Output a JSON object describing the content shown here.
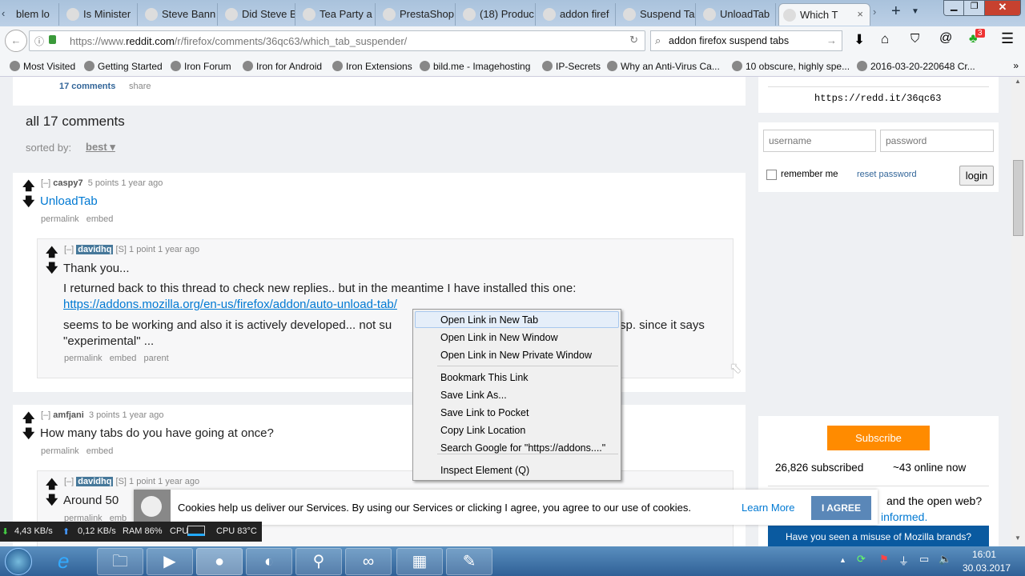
{
  "tabs": [
    {
      "label": "blem lo",
      "icon": "page-icon"
    },
    {
      "label": "Is Minister",
      "icon": "portrait-icon"
    },
    {
      "label": "Steve Bann",
      "icon": "google-icon"
    },
    {
      "label": "Did Steve B",
      "icon": "dollar-icon"
    },
    {
      "label": "Tea Party a",
      "icon": "bird-icon"
    },
    {
      "label": "PrestaShop",
      "icon": "prestashop-icon"
    },
    {
      "label": "(18) Produc",
      "icon": "page-icon"
    },
    {
      "label": "addon firef",
      "icon": "google-icon"
    },
    {
      "label": "Suspend Ta",
      "icon": "puzzle-icon"
    },
    {
      "label": "UnloadTab",
      "icon": "puzzle-icon"
    },
    {
      "label": "Which T",
      "icon": "reddit-icon",
      "active": true
    }
  ],
  "toolbar": {
    "url_prefix": "https://www.",
    "url_domain": "reddit.com",
    "url_path": "/r/firefox/comments/36qc63/which_tab_suspender/",
    "search": "addon firefox suspend tabs",
    "badge": "3"
  },
  "bookmarks": [
    "Most Visited",
    "Getting Started",
    "Iron Forum",
    "Iron for Android",
    "Iron Extensions",
    "bild.me - Imagehosting",
    "IP-Secrets",
    "Why an Anti-Virus Ca...",
    "10 obscure, highly spe...",
    "2016-03-20-220648 Cr..."
  ],
  "post": {
    "comments_link": "17 comments",
    "share": "share",
    "all_comments": "all 17 comments",
    "sorted_by": "sorted by:",
    "sort": "best"
  },
  "comments": [
    {
      "toggle": "[–]",
      "author": "caspy7",
      "points": "5 points",
      "age": "1 year ago",
      "body": "UnloadTab",
      "links": [
        "permalink",
        "embed"
      ]
    },
    {
      "toggle": "[–]",
      "author": "davidhq",
      "op": "[S]",
      "points": "1 point",
      "age": "1 year ago",
      "body1": "Thank you...",
      "body2": "I returned back to this thread to check new replies.. but in the meantime I have installed this one:",
      "link": "https://addons.mozilla.org/en-us/firefox/addon/auto-unload-tab/",
      "body3a": "seems to be working and also it is actively developed... not su",
      "body3b": "sp. since it says",
      "body4": "\"experimental\" ...",
      "links": [
        "permalink",
        "embed",
        "parent"
      ]
    },
    {
      "toggle": "[–]",
      "author": "amfjani",
      "points": "3 points",
      "age": "1 year ago",
      "body": "How many tabs do you have going at once?",
      "links": [
        "permalink",
        "embed"
      ]
    },
    {
      "toggle": "[–]",
      "author": "davidhq",
      "op": "[S]",
      "points": "1 point",
      "age": "1 year ago",
      "body": "Around 50",
      "links": [
        "permalink",
        "emb"
      ]
    }
  ],
  "sidebar": {
    "shortlink": "https://redd.it/36qc63",
    "username_ph": "username",
    "password_ph": "password",
    "remember": "remember me",
    "reset": "reset password",
    "login": "login",
    "subscribe": "Subscribe",
    "subscribed": "26,826 subscribed",
    "online": "~43 online now",
    "q1": "and the open web?",
    "q2": "informed.",
    "misuse": "Have you seen a misuse of Mozilla brands?"
  },
  "context_menu": [
    "Open Link in New Tab",
    "Open Link in New Window",
    "Open Link in New Private Window",
    "Bookmark This Link",
    "Save Link As...",
    "Save Link to Pocket",
    "Copy Link Location",
    "Search Google for \"https://addons....\"",
    "Inspect Element (Q)"
  ],
  "cookie": {
    "text": "Cookies help us deliver our Services. By using our Services or clicking I agree, you agree to our use of cookies.",
    "learn": "Learn More",
    "agree": "I AGREE"
  },
  "monitor": {
    "down": "4,43 KB/s",
    "up": "0,12 KB/s",
    "ram": "RAM 86%",
    "cpu": "CPU",
    "cpu_temp": "CPU 83°C"
  },
  "clock": {
    "time": "16:01",
    "date": "30.03.2017"
  },
  "colors": {
    "accent": "#0079d3",
    "subscribe": "#ff8b00",
    "agree": "#5a87b8",
    "misuse": "#0a5aa0"
  }
}
